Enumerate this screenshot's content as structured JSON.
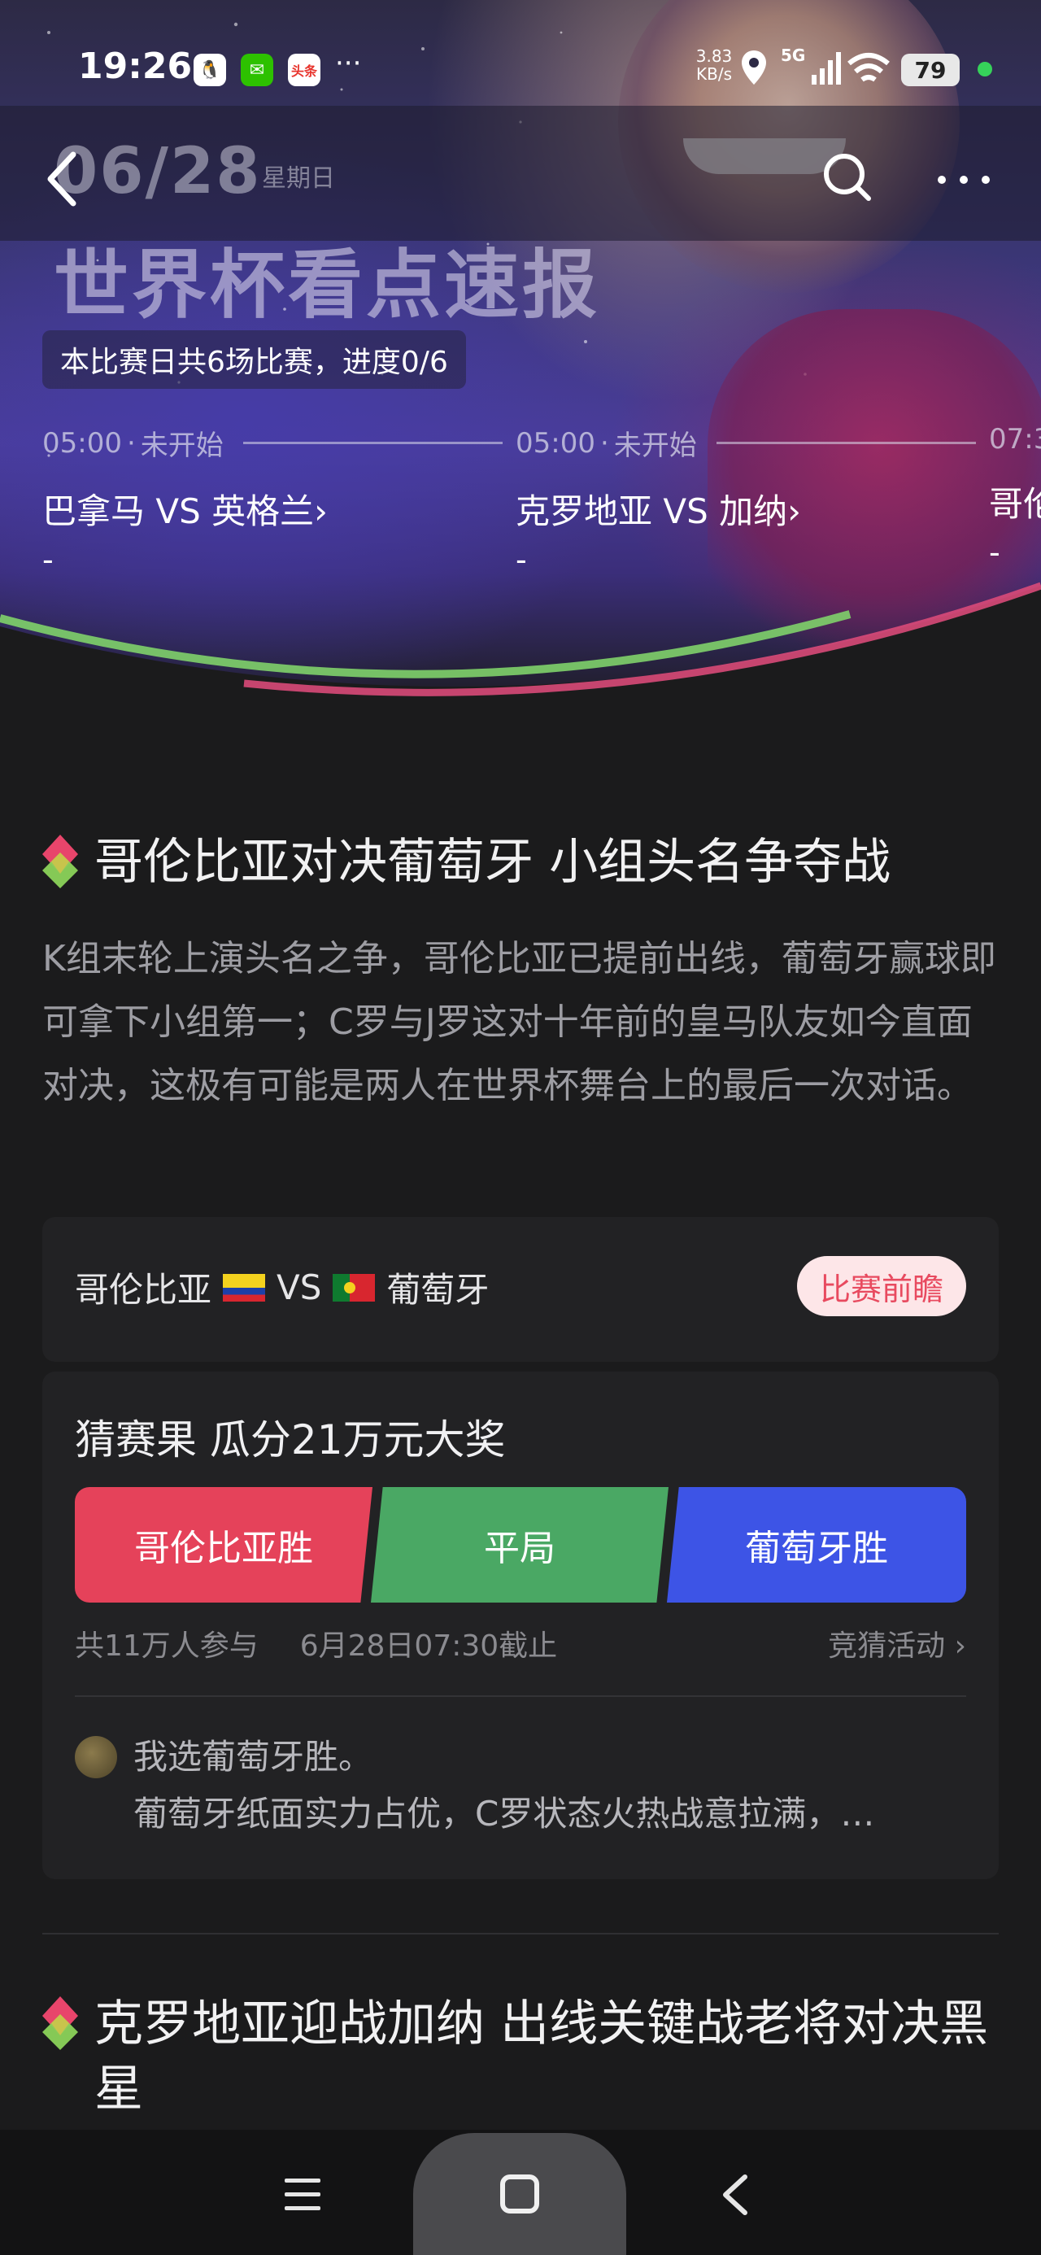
{
  "status_bar": {
    "time": "19:26",
    "apps": [
      {
        "name": "qq-icon",
        "glyph": "🐧",
        "bg": "#ffffff"
      },
      {
        "name": "wechat-icon",
        "glyph": "✉",
        "bg": "#2dc100"
      },
      {
        "name": "toutiao-icon",
        "glyph": "头条",
        "bg": "#e8352e"
      }
    ],
    "more": "···",
    "net_speed": "3.83 KB/s",
    "network": "5G",
    "battery": "79"
  },
  "header": {
    "date": "06/28",
    "weekday": "星期日",
    "title": "世界杯看点速报",
    "progress": "本比赛日共6场比赛，进度0/6"
  },
  "matches": [
    {
      "time": "05:00",
      "status": "未开始",
      "teams": "巴拿马 VS 英格兰›",
      "score": "-"
    },
    {
      "time": "05:00",
      "status": "未开始",
      "teams": "克罗地亚 VS 加纳›",
      "score": "-"
    },
    {
      "time": "07:3",
      "status": "",
      "teams": "哥伦",
      "score": "-"
    }
  ],
  "article1": {
    "title": "哥伦比亚对决葡萄牙 小组头名争夺战",
    "description": "K组末轮上演头名之争，哥伦比亚已提前出线，葡萄牙赢球即可拿下小组第一；C罗与J罗这对十年前的皇马队友如今直面对决，这极有可能是两人在世界杯舞台上的最后一次对话。",
    "match": {
      "home": "哥伦比亚",
      "vs": "VS",
      "away": "葡萄牙",
      "preview_label": "比赛前瞻"
    },
    "quiz": {
      "title": "猜赛果 瓜分21万元大奖",
      "options": [
        "哥伦比亚胜",
        "平局",
        "葡萄牙胜"
      ],
      "participants": "共11万人参与",
      "deadline": "6月28日07:30截止",
      "link": "竞猜活动 ›",
      "comment_pick": "我选葡萄牙胜。",
      "comment_text": "葡萄牙纸面实力占优，C罗状态火热战意拉满，…"
    }
  },
  "article2": {
    "title": "克罗地亚迎战加纳 出线关键战老将对决黑星"
  },
  "colors": {
    "accent_red": "#e5425a",
    "accent_green": "#4aa864",
    "accent_blue": "#3d54e6",
    "preview_bg": "#fde6e8",
    "preview_text": "#e84a5f"
  }
}
